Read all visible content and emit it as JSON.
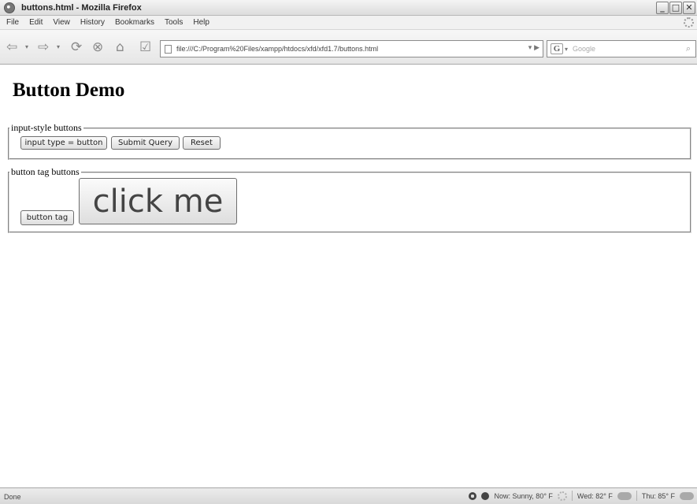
{
  "window": {
    "title": "buttons.html - Mozilla Firefox",
    "controls": {
      "minimize": "_",
      "maximize": "□",
      "close": "✕"
    }
  },
  "menu": [
    "File",
    "Edit",
    "View",
    "History",
    "Bookmarks",
    "Tools",
    "Help"
  ],
  "toolbar": {
    "back_icon": "⇦",
    "dropdown_icon": "▾",
    "forward_icon": "⇨",
    "reload_icon": "⟳",
    "stop_icon": "⊗",
    "home_icon": "⌂",
    "bookmark_icon": "☑",
    "url": "file:///C:/Program%20Files/xampp/htdocs/xfd/xfd1.7/buttons.html",
    "url_arrows": "▾  ▶",
    "search_engine_letter": "G",
    "search_placeholder": "Google",
    "search_icon": "⌕"
  },
  "page": {
    "heading": "Button Demo",
    "fieldset1": {
      "legend": "input-style buttons",
      "buttons": [
        "input type = button",
        "Submit Query",
        "Reset"
      ]
    },
    "fieldset2": {
      "legend": "button tag buttons",
      "buttons": [
        "button tag",
        "click me"
      ]
    }
  },
  "status": {
    "text": "Done",
    "weather_now": "Now: Sunny, 80° F",
    "weather_wed": "Wed: 82° F",
    "weather_thu": "Thu: 85° F"
  }
}
